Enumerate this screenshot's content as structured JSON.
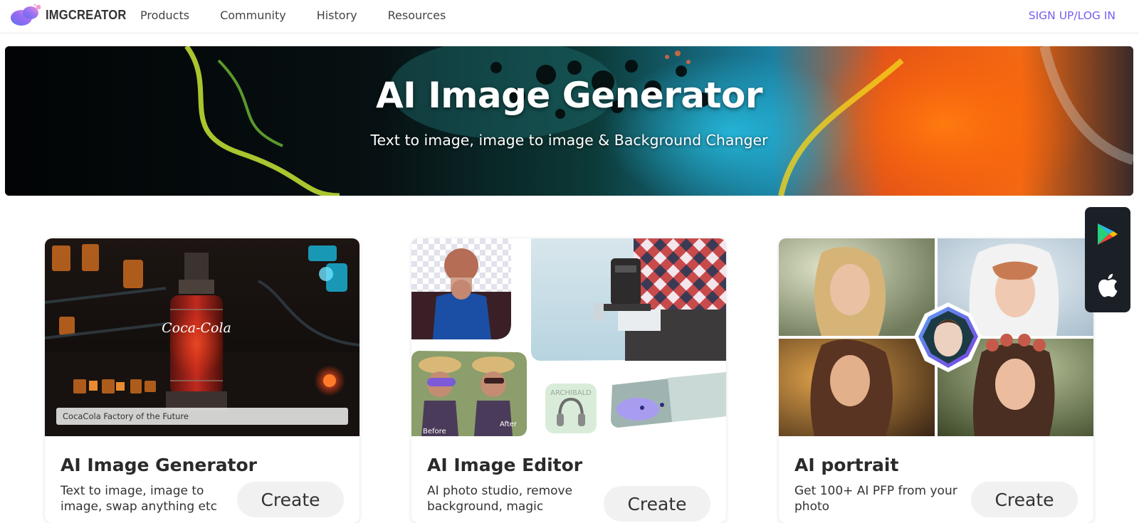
{
  "brand": {
    "name": "IMGCREATOR"
  },
  "nav": {
    "links": [
      "Products",
      "Community",
      "History",
      "Resources"
    ],
    "signup_label": "SIGN UP/LOG IN"
  },
  "hero": {
    "title": "AI Image Generator",
    "subtitle": "Text to image, image to image & Background Changer"
  },
  "cards": [
    {
      "title": "AI Image Generator",
      "description": "Text to image, image to image, swap anything etc",
      "button_label": "Create",
      "image_caption": "CocaCola Factory of the Future",
      "image_logo": "Coca-Cola"
    },
    {
      "title": "AI Image Editor",
      "description": "AI photo studio, remove background, magic",
      "button_label": "Create",
      "labels": {
        "before": "Before",
        "after": "After",
        "product": "ARCHIBALD"
      }
    },
    {
      "title": "AI portrait",
      "description": "Get 100+ AI PFP from your photo",
      "button_label": "Create"
    }
  ],
  "store_panel": {
    "icons": [
      "google-play-icon",
      "apple-icon"
    ]
  },
  "colors": {
    "accent": "#7b5cf0",
    "store_panel_bg": "#1b1f26",
    "button_bg": "#f1f1f1"
  }
}
